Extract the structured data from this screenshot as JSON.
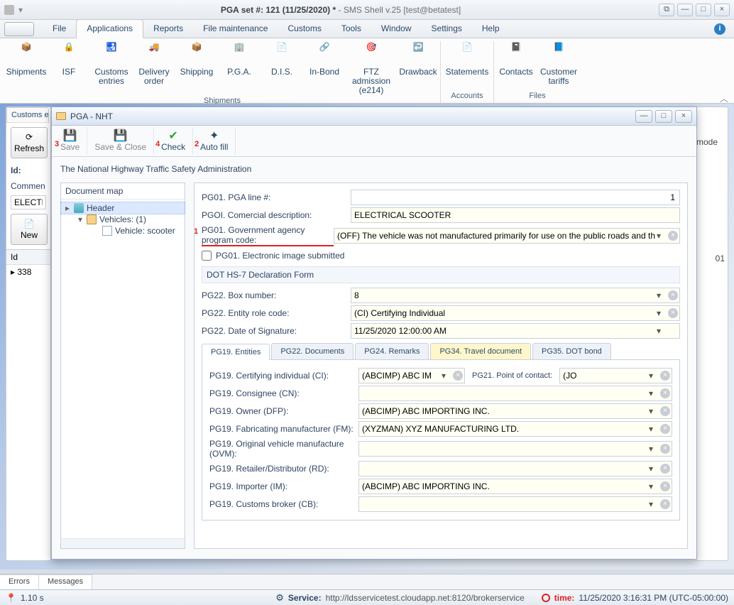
{
  "title": {
    "left": "PGA set #: 121 (11/25/2020) *",
    "right": "- SMS Shell v.25 [test@betatest]"
  },
  "menu": {
    "items": [
      "File",
      "Applications",
      "Reports",
      "File maintenance",
      "Customs",
      "Tools",
      "Window",
      "Settings",
      "Help"
    ],
    "active": "Applications"
  },
  "ribbon": {
    "groups": [
      {
        "label": "Shipments",
        "buttons": [
          "Shipments",
          "ISF",
          "Customs entries",
          "Delivery order",
          "Shipping",
          "P.G.A.",
          "D.I.S.",
          "In-Bond",
          "FTZ admission (e214)",
          "Drawback"
        ]
      },
      {
        "label": "Accounts",
        "buttons": [
          "Statements"
        ]
      },
      {
        "label": "Files",
        "buttons": [
          "Contacts",
          "Customer tariffs"
        ]
      }
    ]
  },
  "bgPanel": {
    "tab": "Customs e",
    "refresh": "Refresh",
    "id_label": "Id:",
    "comment_label": "Commen",
    "electric": "ELECTRI",
    "new": "New",
    "grid_header": "Id",
    "grid_row": "338"
  },
  "bgRight": {
    "mode": "mode",
    "code": "01"
  },
  "pga": {
    "title": "PGA - NHT",
    "toolbar": {
      "save": "Save",
      "save_close": "Save & Close",
      "check": "Check",
      "autofill": "Auto fill",
      "mark3": "3",
      "mark4": "4",
      "mark2": "2"
    },
    "admin": "The National Highway Traffic Safety Administration",
    "tree": {
      "title": "Document map",
      "header": "Header",
      "vehicles": "Vehicles: (1)",
      "vehicle": "Vehicle: scooter"
    },
    "form": {
      "pg01_line_lbl": "PG01. PGA line #:",
      "pg01_line_val": "1",
      "pgoi_desc_lbl": "PGOI. Comercial description:",
      "pgoi_desc_val": "ELECTRICAL SCOOTER",
      "pg01_code_lbl": "PG01. Government agency program code:",
      "pg01_code_val": "(OFF) The vehicle was not manufactured primarily for use on the public roads and th",
      "pg01_code_mark": "1",
      "pg01_img_lbl": "PG01. Electronic image submitted",
      "dot_section": "DOT HS-7 Declaration Form",
      "pg22_box_lbl": "PG22. Box number:",
      "pg22_box_val": "8",
      "pg22_role_lbl": "PG22. Entity role code:",
      "pg22_role_val": "(CI) Certifying Individual",
      "pg22_date_lbl": "PG22. Date of Signature:",
      "pg22_date_val": "11/25/2020 12:00:00 AM",
      "tabs": [
        "PG19. Entities",
        "PG22. Documents",
        "PG24. Remarks",
        "PG34. Travel document",
        "PG35. DOT bond"
      ],
      "entities": {
        "ci_lbl": "PG19. Certifying individual (CI):",
        "ci_val": "(ABCIMP) ABC IM",
        "poc_lbl": "PG21. Point of contact:",
        "poc_val": "(JO",
        "cn_lbl": "PG19. Consignee (CN):",
        "cn_val": "",
        "dfp_lbl": "PG19. Owner (DFP):",
        "dfp_val": "(ABCIMP) ABC IMPORTING INC.",
        "fm_lbl": "PG19. Fabricating manufacturer (FM):",
        "fm_val": "(XYZMAN) XYZ MANUFACTURING LTD.",
        "ovm_lbl": "PG19. Original vehicle manufacture (OVM):",
        "ovm_val": "",
        "rd_lbl": "PG19. Retailer/Distributor (RD):",
        "rd_val": "",
        "im_lbl": "PG19. Importer (IM):",
        "im_val": "(ABCIMP) ABC IMPORTING INC.",
        "cb_lbl": "PG19. Customs broker (CB):",
        "cb_val": ""
      }
    }
  },
  "bottom_tabs": [
    "Errors",
    "Messages"
  ],
  "status": {
    "elapsed": "1.10 s",
    "svc_label": "Service:",
    "svc_url": "http://ldsservicetest.cloudapp.net:8120/brokerservice",
    "time_label": "time:",
    "time_val": "11/25/2020 3:16:31 PM (UTC-05:00:00)"
  },
  "icons": {
    "shipments": "📦",
    "isf": "🔒",
    "customs": "🛃",
    "delivery": "🚚",
    "shipping": "📦",
    "pga": "🏢",
    "dis": "📄",
    "inbond": "🔗",
    "ftz": "🎯",
    "drawback": "↩️",
    "statements": "📄",
    "contacts": "📓",
    "tariffs": "📘"
  }
}
